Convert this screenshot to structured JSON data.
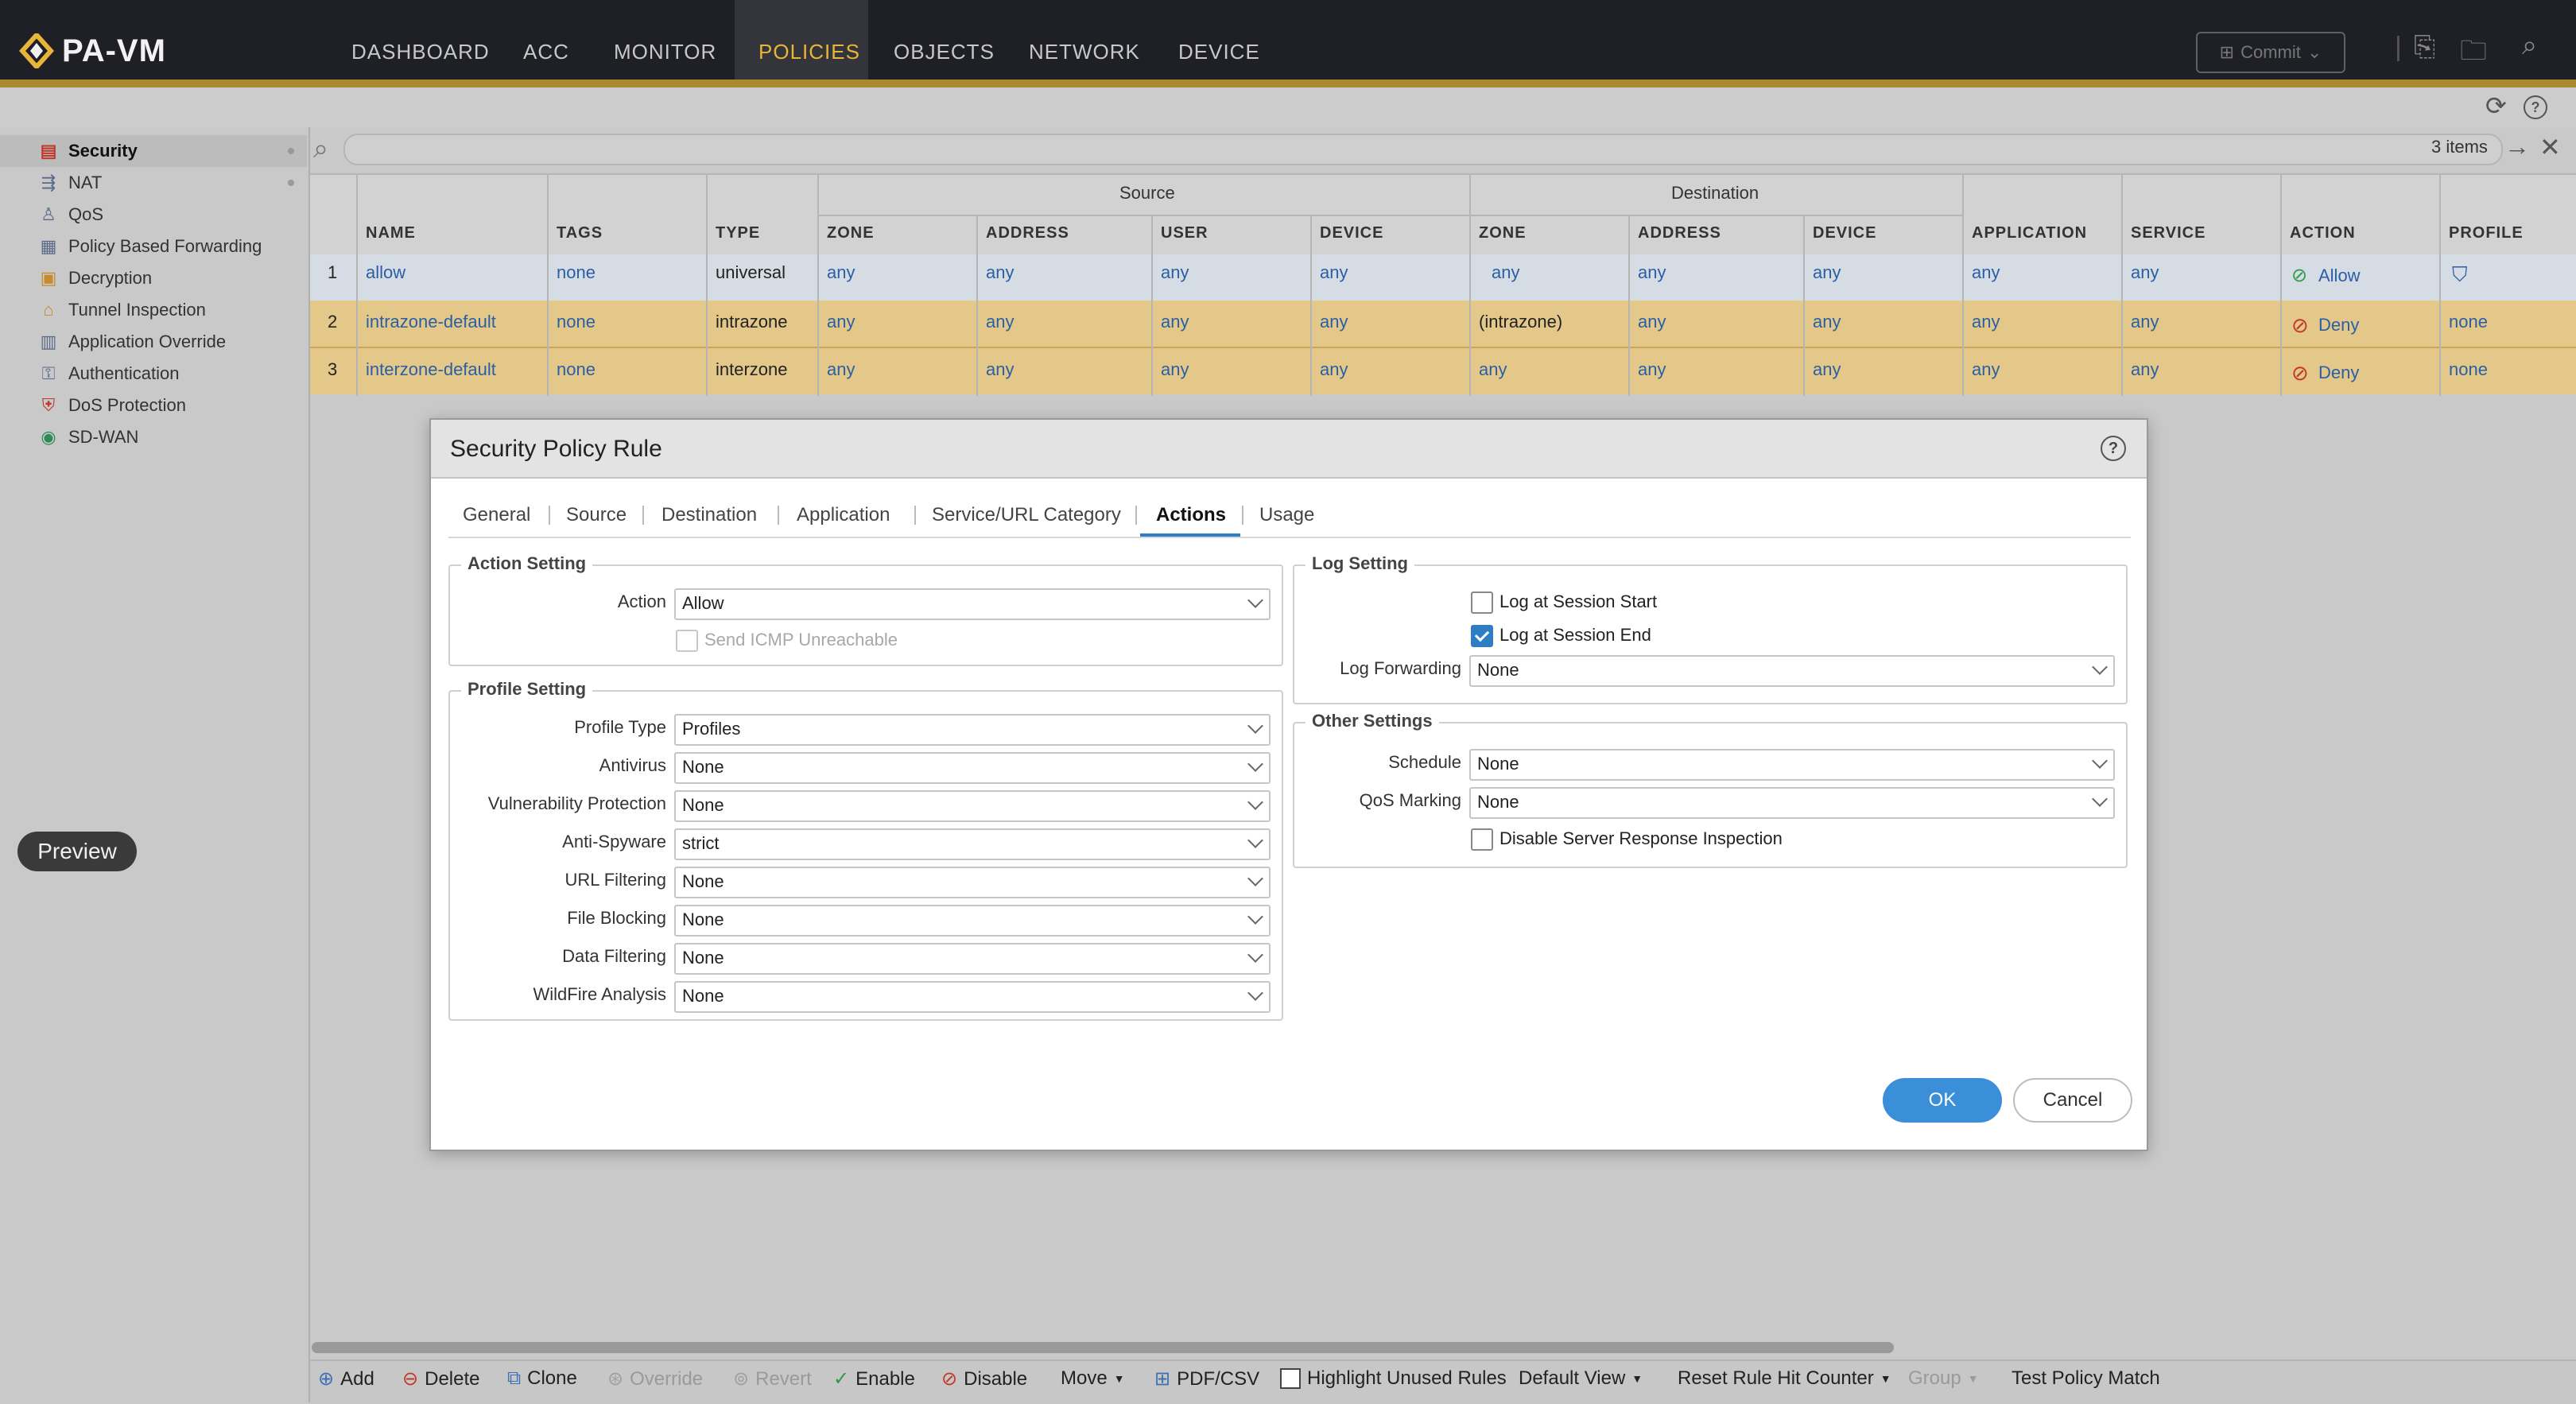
{
  "app": {
    "name": "PA-VM"
  },
  "nav": [
    "DASHBOARD",
    "ACC",
    "MONITOR",
    "POLICIES",
    "OBJECTS",
    "NETWORK",
    "DEVICE"
  ],
  "nav_active": "POLICIES",
  "commit_label": "Commit",
  "sidebar": {
    "items": [
      {
        "label": "Security",
        "icon": "security-icon"
      },
      {
        "label": "NAT",
        "icon": "nat-icon"
      },
      {
        "label": "QoS",
        "icon": "qos-icon"
      },
      {
        "label": "Policy Based Forwarding",
        "icon": "pbf-icon"
      },
      {
        "label": "Decryption",
        "icon": "decryption-icon"
      },
      {
        "label": "Tunnel Inspection",
        "icon": "tunnel-icon"
      },
      {
        "label": "Application Override",
        "icon": "app-override-icon"
      },
      {
        "label": "Authentication",
        "icon": "authentication-icon"
      },
      {
        "label": "DoS Protection",
        "icon": "dos-icon"
      },
      {
        "label": "SD-WAN",
        "icon": "sdwan-icon"
      }
    ],
    "preview_label": "Preview"
  },
  "search": {
    "count": "3 items"
  },
  "table": {
    "group_headers": {
      "source": "Source",
      "destination": "Destination"
    },
    "headers": [
      "NAME",
      "TAGS",
      "TYPE",
      "ZONE",
      "ADDRESS",
      "USER",
      "DEVICE",
      "ZONE",
      "ADDRESS",
      "DEVICE",
      "APPLICATION",
      "SERVICE",
      "ACTION",
      "PROFILE"
    ],
    "rows": [
      {
        "num": "1",
        "name": "allow",
        "tags": "none",
        "type": "universal",
        "src_zone": "any",
        "src_address": "any",
        "src_user": "any",
        "src_device": "any",
        "dst_zone": "any",
        "dst_address": "any",
        "dst_device": "any",
        "application": "any",
        "service": "any",
        "action": "Allow",
        "profile": ""
      },
      {
        "num": "2",
        "name": "intrazone-default",
        "tags": "none",
        "type": "intrazone",
        "src_zone": "any",
        "src_address": "any",
        "src_user": "any",
        "src_device": "any",
        "dst_zone": "(intrazone)",
        "dst_address": "any",
        "dst_device": "any",
        "application": "any",
        "service": "any",
        "action": "Deny",
        "profile": "none"
      },
      {
        "num": "3",
        "name": "interzone-default",
        "tags": "none",
        "type": "interzone",
        "src_zone": "any",
        "src_address": "any",
        "src_user": "any",
        "src_device": "any",
        "dst_zone": "any",
        "dst_address": "any",
        "dst_device": "any",
        "application": "any",
        "service": "any",
        "action": "Deny",
        "profile": "none"
      }
    ]
  },
  "modal": {
    "title": "Security Policy Rule",
    "tabs": [
      "General",
      "Source",
      "Destination",
      "Application",
      "Service/URL Category",
      "Actions",
      "Usage"
    ],
    "active_tab": "Actions",
    "action_setting": {
      "legend": "Action Setting",
      "action_label": "Action",
      "action_value": "Allow",
      "icmp_label": "Send ICMP Unreachable",
      "icmp_checked": false
    },
    "profile_setting": {
      "legend": "Profile Setting",
      "fields": [
        {
          "label": "Profile Type",
          "value": "Profiles"
        },
        {
          "label": "Antivirus",
          "value": "None"
        },
        {
          "label": "Vulnerability Protection",
          "value": "None"
        },
        {
          "label": "Anti-Spyware",
          "value": "strict"
        },
        {
          "label": "URL Filtering",
          "value": "None"
        },
        {
          "label": "File Blocking",
          "value": "None"
        },
        {
          "label": "Data Filtering",
          "value": "None"
        },
        {
          "label": "WildFire Analysis",
          "value": "None"
        }
      ]
    },
    "log_setting": {
      "legend": "Log Setting",
      "log_start_label": "Log at Session Start",
      "log_start_checked": false,
      "log_end_label": "Log at Session End",
      "log_end_checked": true,
      "forwarding_label": "Log Forwarding",
      "forwarding_value": "None"
    },
    "other_settings": {
      "legend": "Other Settings",
      "schedule_label": "Schedule",
      "schedule_value": "None",
      "qos_label": "QoS Marking",
      "qos_value": "None",
      "dsri_label": "Disable Server Response Inspection",
      "dsri_checked": false
    },
    "ok_label": "OK",
    "cancel_label": "Cancel"
  },
  "toolbar": {
    "add": "Add",
    "delete": "Delete",
    "clone": "Clone",
    "override": "Override",
    "revert": "Revert",
    "enable": "Enable",
    "disable": "Disable",
    "move": "Move",
    "pdfcsv": "PDF/CSV",
    "highlight": "Highlight Unused Rules",
    "default_view": "Default View",
    "reset_counter": "Reset Rule Hit Counter",
    "group": "Group",
    "test_policy": "Test Policy Match"
  },
  "colors": {
    "accent": "#e8b53b",
    "link": "#2b5fa5",
    "primary_button": "#3b8fd8",
    "row_highlight": "#e6c98a"
  }
}
